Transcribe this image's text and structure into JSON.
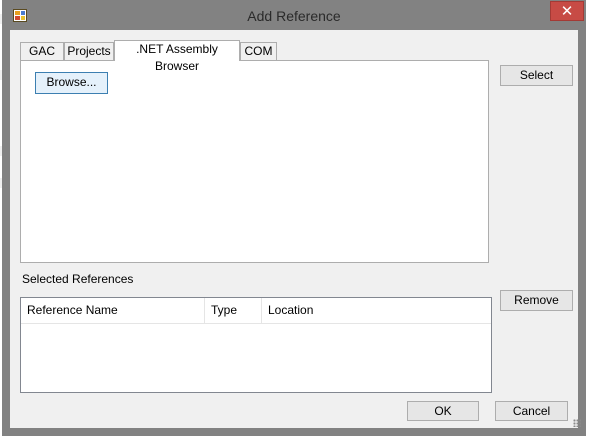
{
  "window": {
    "title": "Add Reference",
    "close_glyph": "✕"
  },
  "tabs": [
    {
      "label": "GAC"
    },
    {
      "label": "Projects"
    },
    {
      "label": ".NET Assembly Browser"
    },
    {
      "label": "COM"
    }
  ],
  "assembly_browser": {
    "browse_label": "Browse..."
  },
  "buttons": {
    "select": "Select",
    "remove": "Remove",
    "ok": "OK",
    "cancel": "Cancel"
  },
  "selected_references": {
    "label": "Selected References",
    "columns": [
      "Reference Name",
      "Type",
      "Location"
    ]
  },
  "icons": {
    "app": "add-reference-app-icon",
    "close": "close-icon",
    "grip": "resize-grip-icon"
  }
}
